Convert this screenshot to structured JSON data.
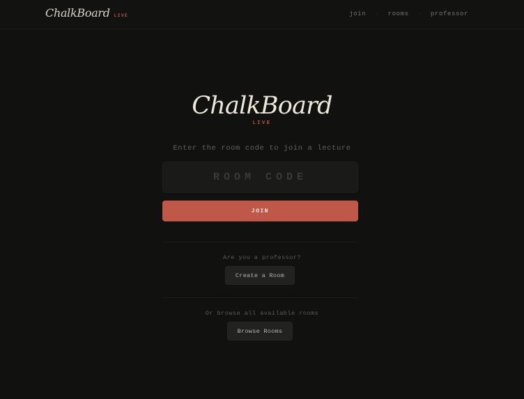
{
  "header": {
    "brand": "ChalkBoard",
    "badge": "LIVE",
    "nav": [
      "join",
      "rooms",
      "professor"
    ]
  },
  "hero": {
    "title": "ChalkBoard",
    "badge": "LIVE",
    "subtitle": "Enter the room code to join a lecture"
  },
  "join_form": {
    "room_code_placeholder": "ROOM CODE",
    "room_code_value": "",
    "join_label": "JOIN"
  },
  "professor": {
    "prompt": "Are you a professor?",
    "button_label": "Create a Room"
  },
  "browse": {
    "prompt": "Or browse all available rooms",
    "button_label": "Browse Rooms"
  },
  "colors": {
    "background": "#111110",
    "accent": "#c0584a",
    "text": "#ede8dc"
  }
}
